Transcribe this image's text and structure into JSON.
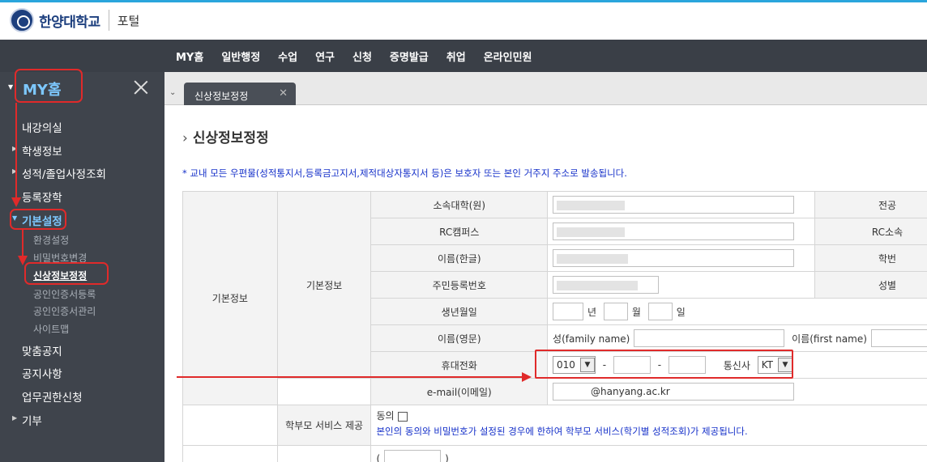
{
  "header": {
    "university": "한양대학교",
    "portal": "포털"
  },
  "nav": [
    "MY홈",
    "일반행정",
    "수업",
    "연구",
    "신청",
    "증명발급",
    "취업",
    "온라인민원"
  ],
  "sidebar": {
    "home_label": "MY홈",
    "items": [
      {
        "label": "내강의실"
      },
      {
        "label": "학생정보"
      },
      {
        "label": "성적/졸업사정조회"
      },
      {
        "label": "등록장학"
      },
      {
        "label": "기본설정"
      },
      {
        "label": "맞춤공지"
      },
      {
        "label": "공지사항"
      },
      {
        "label": "업무권한신청"
      },
      {
        "label": "기부"
      }
    ],
    "subitems": [
      {
        "label": "환경설정"
      },
      {
        "label": "비밀번호변경"
      },
      {
        "label": "신상정보정정"
      },
      {
        "label": "공인인증서등록"
      },
      {
        "label": "공인인증서관리"
      },
      {
        "label": "사이트맵"
      }
    ]
  },
  "tab": {
    "label": "신상정보정정"
  },
  "page": {
    "title": "신상정보정정",
    "notice": "* 교내 모든 우편물(성적통지서,등록금고지서,제적대상자통지서 등)은 보호자 또는 본인 거주지 주소로 발송됩니다."
  },
  "form": {
    "section": "기본정보",
    "subsection": "기본정보",
    "labels": {
      "college": "소속대학(원)",
      "major": "전공",
      "rc_campus": "RC캠퍼스",
      "rc_affil": "RC소속",
      "name_kr": "이름(한글)",
      "student_no": "학번",
      "resident_no": "주민등록번호",
      "gender": "성별",
      "birth": "생년월일",
      "name_en": "이름(영문)",
      "mobile": "휴대전화",
      "email": "e-mail(이메일)",
      "parent_service": "학부모 서비스 제공"
    },
    "birth_units": {
      "year": "년",
      "month": "월",
      "day": "일"
    },
    "family_name_label": "성(family name)",
    "first_name_label": "이름(first name)",
    "phone_prefix": "010",
    "carrier_label": "통신사",
    "carrier": "KT",
    "email_domain": "@hanyang.ac.kr",
    "consent_label": "동의",
    "consent_note": "본인의 동의와 비밀번호가 설정된 경우에 한하여 학부모 서비스(학기별 성적조회)가 제공됩니다."
  }
}
